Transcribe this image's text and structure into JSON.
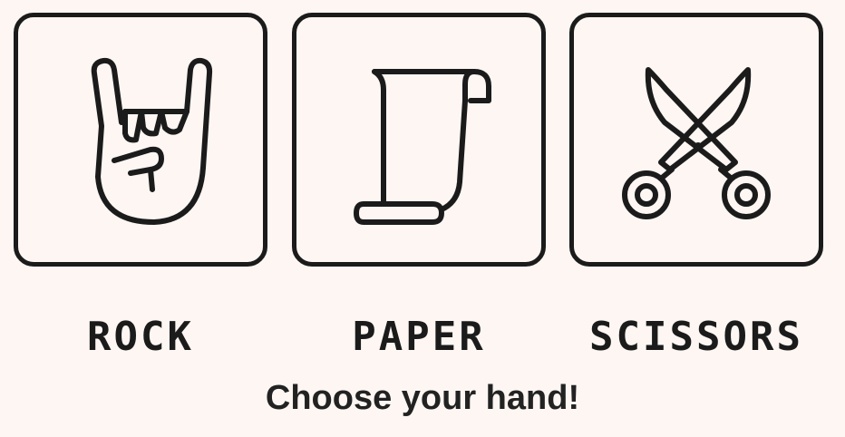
{
  "choices": [
    {
      "id": "rock",
      "label": "ROCK",
      "icon": "rock-hand-icon"
    },
    {
      "id": "paper",
      "label": "PAPER",
      "icon": "paper-scroll-icon"
    },
    {
      "id": "scissors",
      "label": "SCISSORS",
      "icon": "scissors-icon"
    }
  ],
  "prompt": "Choose your hand!",
  "colors": {
    "background": "#fdf6f3",
    "ink": "#1b1b1b"
  }
}
